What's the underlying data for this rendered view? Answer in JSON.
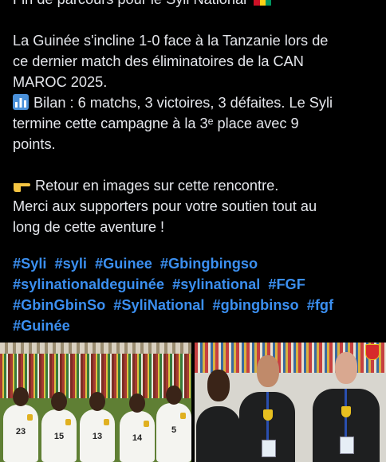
{
  "post": {
    "title_line": "Fin de parcours pour le Syli National",
    "flag_colors": [
      "#ce1126",
      "#fcd116",
      "#009460"
    ],
    "paragraph1": [
      "La Guinée s'incline 1-0 face à la Tanzanie lors de",
      "ce dernier match des éliminatoires de la CAN",
      "MAROC 2025."
    ],
    "bilan_icon": "bar-chart-emoji",
    "bilan_lines": [
      "Bilan : 6 matchs, 3 victoires, 3 défaites. Le Syli",
      "termine cette campagne à la 3ᵉ place avec 9",
      "points."
    ],
    "pointing_icon": "pointing-hand-emoji",
    "paragraph3": [
      "Retour en images sur cette rencontre.",
      "Merci aux supporters pour votre soutien tout au",
      "long de cette aventure !"
    ]
  },
  "hashtags": {
    "lines": [
      [
        "#Syli",
        "#syli",
        "#Guinee",
        "#Gbingbingso"
      ],
      [
        "#sylinationaldeguinée",
        "#sylinational",
        "#FGF"
      ],
      [
        "#GbinGbinSo",
        "#SyliNational",
        "#gbingbinso",
        "#fgf"
      ],
      [
        "#Guinée"
      ]
    ]
  },
  "photos": {
    "left": {
      "description_icon": "team-photo",
      "player_numbers": [
        "23",
        "15",
        "13",
        "14",
        "5"
      ]
    },
    "right": {
      "description_icon": "staff-photo"
    }
  },
  "colors": {
    "background": "#000000",
    "text": "#e4e6eb",
    "hashtag": "#3b8ff0"
  }
}
